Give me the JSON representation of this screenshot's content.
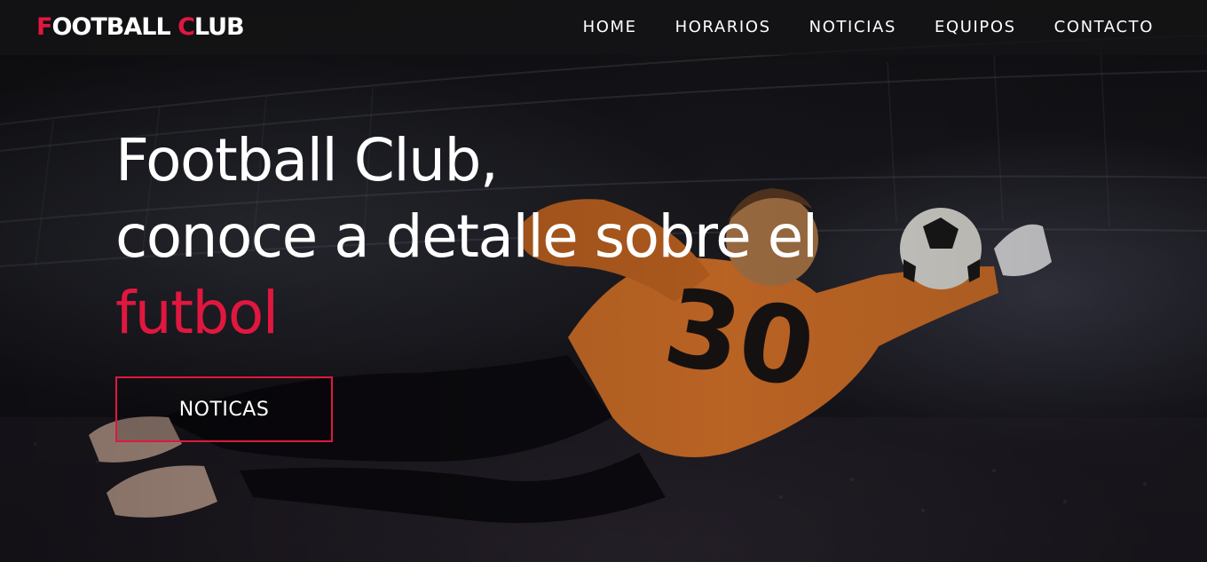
{
  "brand": {
    "logo_part1": "F",
    "logo_part2": "OOTBALL ",
    "logo_part3": "C",
    "logo_part4": "LUB"
  },
  "nav": {
    "items": [
      {
        "label": "HOME"
      },
      {
        "label": "HORARIOS"
      },
      {
        "label": "NOTICIAS"
      },
      {
        "label": "EQUIPOS"
      },
      {
        "label": "CONTACTO"
      }
    ]
  },
  "hero": {
    "line1": "Football Club,",
    "line2": "conoce a detalle sobre el",
    "line3": "futbol",
    "cta_label": "NOTICAS",
    "jersey_number": "30"
  },
  "colors": {
    "accent": "#e0173f",
    "text": "#ffffff",
    "nav_bg": "#141416",
    "jersey": "#d9742a"
  }
}
